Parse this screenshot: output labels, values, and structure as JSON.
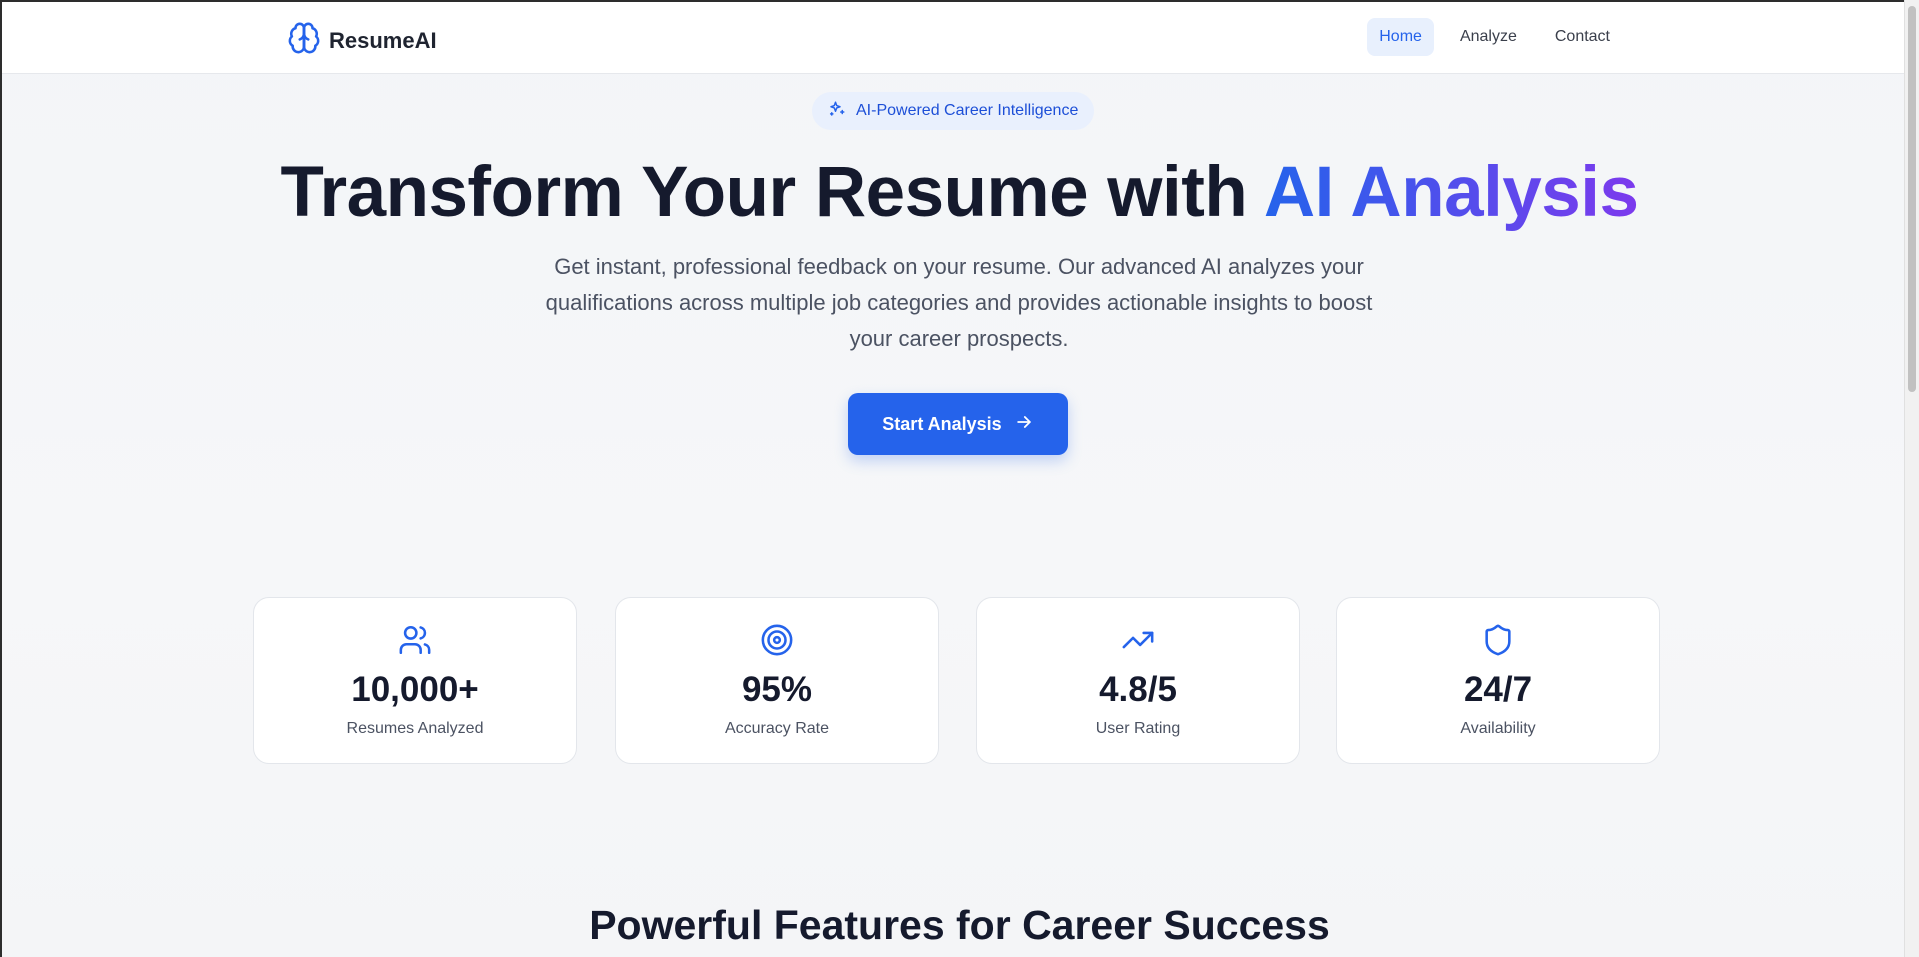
{
  "app": {
    "name": "ResumeAI"
  },
  "nav": {
    "items": [
      {
        "label": "Home",
        "active": true
      },
      {
        "label": "Analyze",
        "active": false
      },
      {
        "label": "Contact",
        "active": false
      }
    ]
  },
  "hero": {
    "badge": "AI-Powered Career Intelligence",
    "title_main": "Transform Your Resume with ",
    "title_accent": "AI Analysis",
    "subtitle": "Get instant, professional feedback on your resume. Our advanced AI analyzes your qualifications across multiple job categories and provides actionable insights to boost your career prospects.",
    "cta_label": "Start Analysis"
  },
  "stats": [
    {
      "icon": "users-icon",
      "value": "10,000+",
      "label": "Resumes Analyzed"
    },
    {
      "icon": "target-icon",
      "value": "95%",
      "label": "Accuracy Rate"
    },
    {
      "icon": "trending-up-icon",
      "value": "4.8/5",
      "label": "User Rating"
    },
    {
      "icon": "shield-icon",
      "value": "24/7",
      "label": "Availability"
    }
  ],
  "features": {
    "title": "Powerful Features for Career Success"
  },
  "colors": {
    "accent": "#2563eb",
    "gradient_end": "#7c3aed",
    "text_dark": "#151a2d"
  }
}
